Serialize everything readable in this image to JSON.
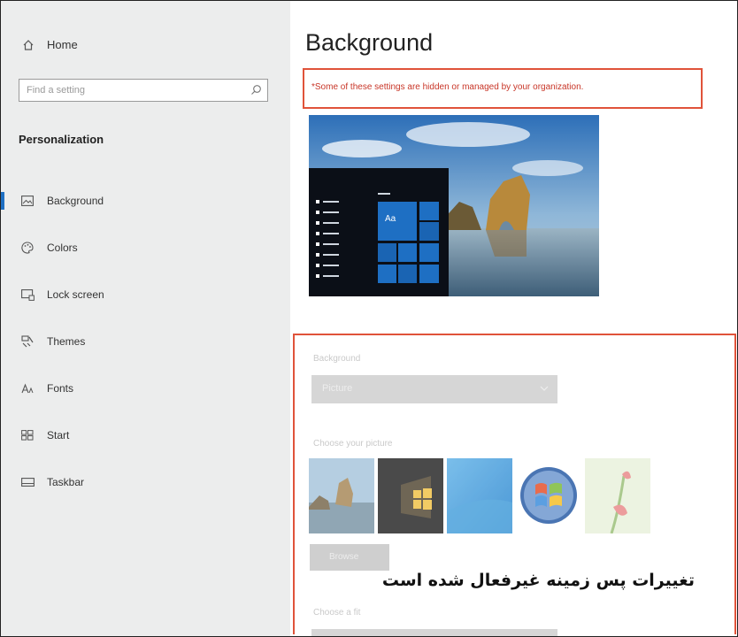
{
  "sidebar": {
    "home_label": "Home",
    "search_placeholder": "Find a setting",
    "section_title": "Personalization",
    "items": [
      {
        "label": "Background",
        "icon": "image-icon"
      },
      {
        "label": "Colors",
        "icon": "palette-icon"
      },
      {
        "label": "Lock screen",
        "icon": "lock-screen-icon"
      },
      {
        "label": "Themes",
        "icon": "brush-icon"
      },
      {
        "label": "Fonts",
        "icon": "font-icon"
      },
      {
        "label": "Start",
        "icon": "start-icon"
      },
      {
        "label": "Taskbar",
        "icon": "taskbar-icon"
      }
    ],
    "active_index": 0
  },
  "main": {
    "title": "Background",
    "warning": "*Some of these settings are hidden or managed by your organization.",
    "preview_tile_text": "Aa",
    "background_label": "Background",
    "background_value": "Picture",
    "choose_picture_label": "Choose your picture",
    "browse_label": "Browse",
    "choose_fit_label": "Choose a fit",
    "caption": "تغییرات پس زمینه غیرفعال شده است"
  },
  "colors": {
    "accent": "#1e6fc3",
    "warning_red": "#e0533a",
    "sidebar_bg": "#eceded"
  }
}
